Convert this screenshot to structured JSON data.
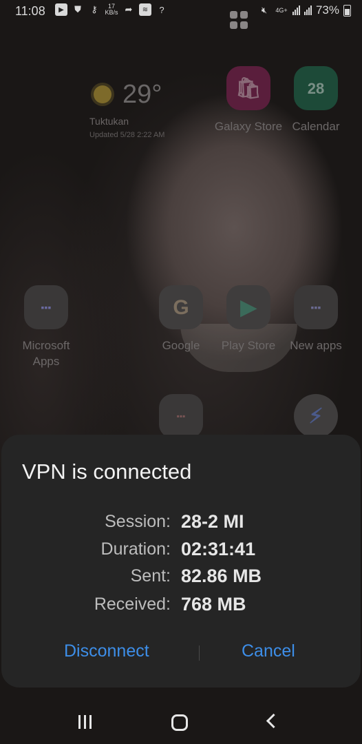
{
  "status_bar": {
    "time": "11:08",
    "network_speed": "17",
    "network_speed_unit": "KB/s",
    "network_type": "4G+",
    "battery": "73%"
  },
  "home": {
    "weather": {
      "temperature": "29°",
      "location": "Tuktukan",
      "updated": "Updated 5/28 2:22 AM"
    },
    "apps": [
      {
        "label": "Galaxy Store",
        "icon": "galaxy-store-icon"
      },
      {
        "label": "Calendar",
        "icon": "calendar-icon",
        "badge": "28"
      },
      {
        "label": "Microsoft Apps",
        "icon": "microsoft-folder-icon"
      },
      {
        "label": "Google",
        "icon": "google-icon"
      },
      {
        "label": "Play Store",
        "icon": "play-store-icon"
      },
      {
        "label": "New apps",
        "icon": "new-apps-folder-icon"
      }
    ]
  },
  "dialog": {
    "title": "VPN is connected",
    "rows": [
      {
        "label": "Session:",
        "value": "28-2 MI"
      },
      {
        "label": "Duration:",
        "value": "02:31:41"
      },
      {
        "label": "Sent:",
        "value": "82.86 MB"
      },
      {
        "label": "Received:",
        "value": "768 MB"
      }
    ],
    "disconnect_label": "Disconnect",
    "cancel_label": "Cancel"
  },
  "colors": {
    "dialog_background": "#252525",
    "accent": "#3d8ee8"
  }
}
